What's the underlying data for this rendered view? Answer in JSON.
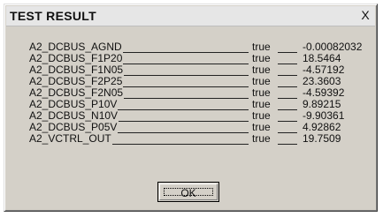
{
  "window": {
    "title": "TEST RESULT",
    "close_label": "X"
  },
  "results": [
    {
      "name": "A2_DCBUS_AGND",
      "status": "true",
      "value": "-0.00082032"
    },
    {
      "name": "A2_DCBUS_F1P20",
      "status": "true",
      "value": "18.5464"
    },
    {
      "name": "A2_DCBUS_F1N05",
      "status": "true",
      "value": "-4.57192"
    },
    {
      "name": "A2_DCBUS_F2P25",
      "status": "true",
      "value": "23.3603"
    },
    {
      "name": "A2_DCBUS_F2N05",
      "status": "true",
      "value": "-4.59392"
    },
    {
      "name": "A2_DCBUS_P10V",
      "status": "true",
      "value": "9.89215"
    },
    {
      "name": "A2_DCBUS_N10V",
      "status": "true",
      "value": "-9.90361"
    },
    {
      "name": "A2_DCBUS_P05V",
      "status": "true",
      "value": "4.92862"
    },
    {
      "name": "A2_VCTRL_OUT",
      "status": "true",
      "value": "19.7509"
    }
  ],
  "buttons": {
    "ok_label": "OK"
  }
}
